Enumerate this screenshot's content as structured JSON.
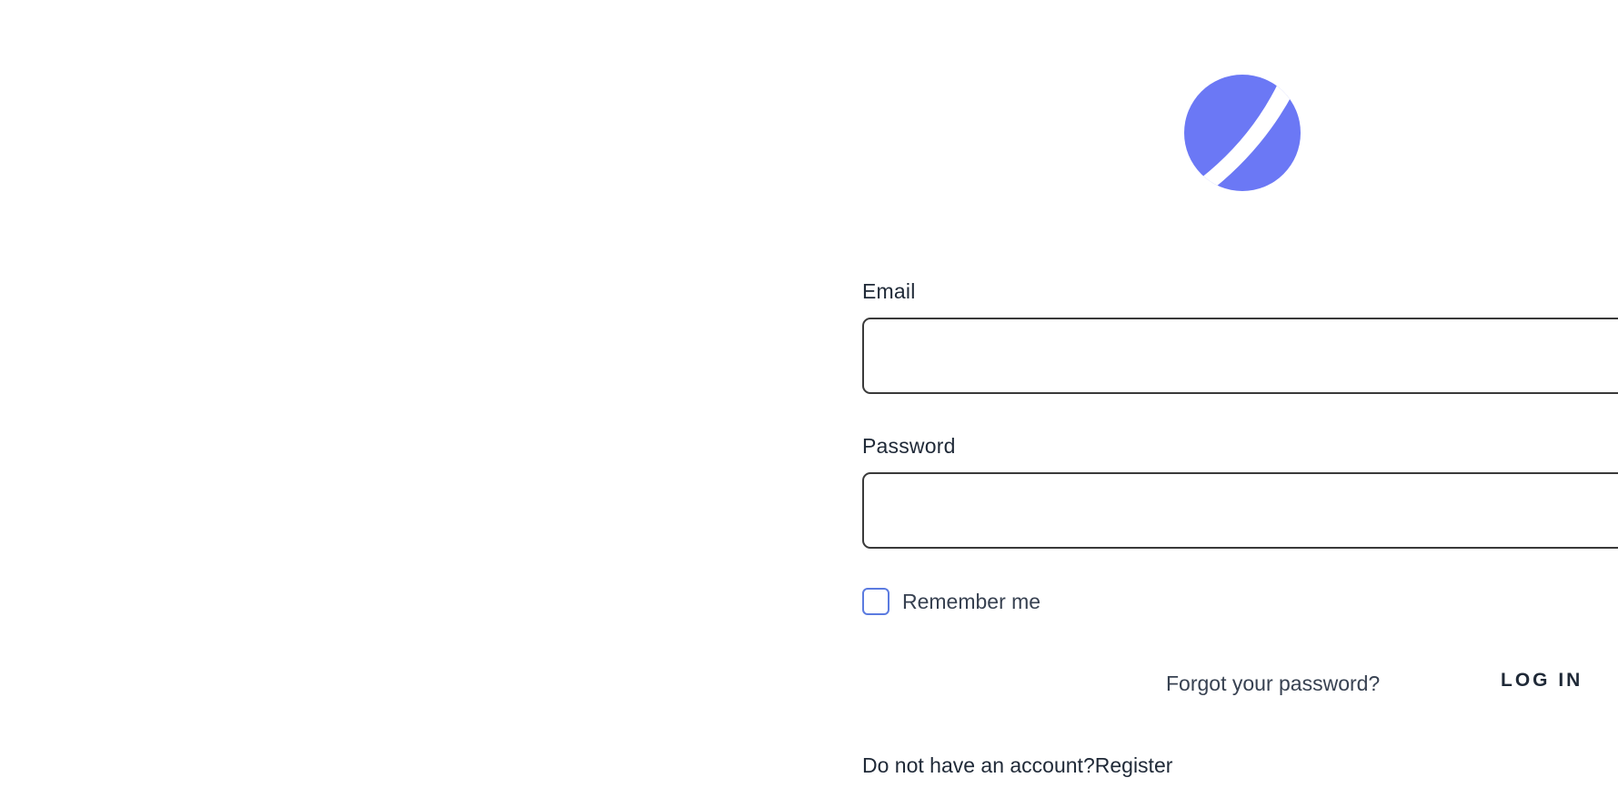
{
  "brand": {
    "logo_icon": "planet-logo-icon",
    "logo_color": "#6b78f5"
  },
  "form": {
    "email": {
      "label": "Email",
      "value": "",
      "placeholder": ""
    },
    "password": {
      "label": "Password",
      "value": "",
      "placeholder": ""
    },
    "remember": {
      "label": "Remember me",
      "checked": false
    },
    "forgot_password_link": "Forgot your password?",
    "login_button": "LOG IN",
    "register_prompt": "Do not have an account?",
    "register_link": "Register"
  },
  "colors": {
    "checkbox_border": "#5b7be0",
    "input_border": "#3a3a3a",
    "text": "#1f2937"
  }
}
